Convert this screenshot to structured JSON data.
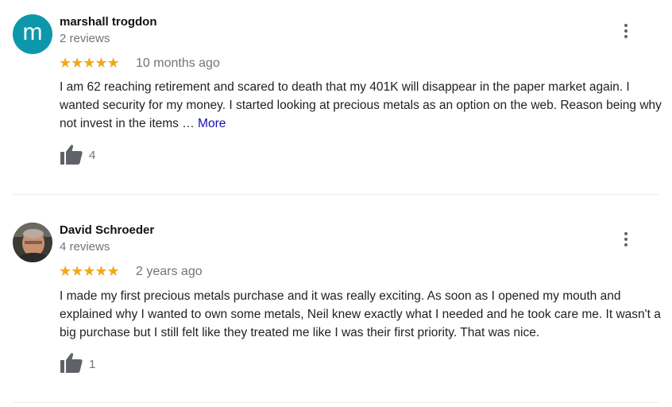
{
  "reviews": [
    {
      "avatar_letter": "m",
      "name": "marshall trogdon",
      "review_count": "2 reviews",
      "rating": 5,
      "stars_text": "★★★★★",
      "date": "10 months ago",
      "text": "I am 62 reaching retirement and scared to death that my 401K will disappear in the paper market again. I wanted security for my money. I started looking at precious metals as an option on the web. Reason being why not invest in the items ",
      "ellipsis": "…",
      "more_label": "More",
      "likes": "4"
    },
    {
      "name": "David Schroeder",
      "review_count": "4 reviews",
      "rating": 5,
      "stars_text": "★★★★★",
      "date": "2 years ago",
      "text": "I made my first precious metals purchase and it was really exciting. As soon as I opened my mouth and explained why I wanted to own some metals, Neil knew exactly what I needed and he took care me.  It wasn't a big purchase but I still felt like they treated me like I was their first priority. That was nice.",
      "likes": "1"
    }
  ],
  "icons": {
    "thumbs_up": "thumbs-up-icon",
    "more_options": "more-vert-icon"
  },
  "colors": {
    "avatar_bg": "#0d97ab",
    "star": "#f2a818",
    "link": "#1a0dab",
    "muted": "#70757a"
  }
}
